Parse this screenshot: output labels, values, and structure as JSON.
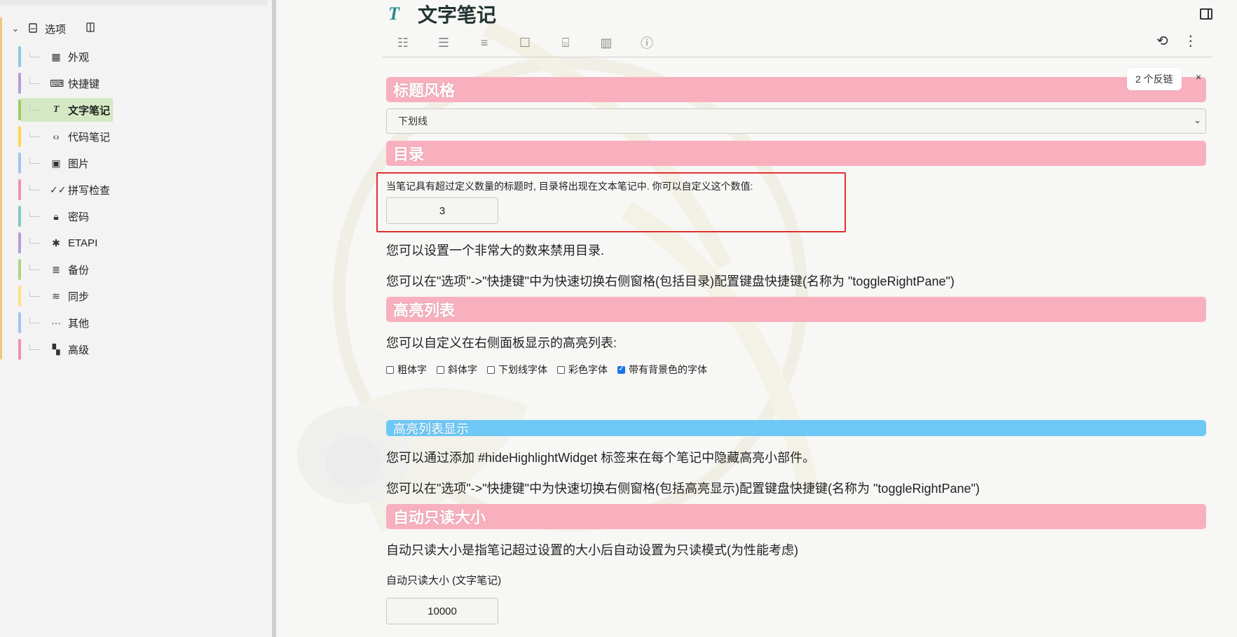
{
  "sidebar": {
    "root": {
      "label": "选项",
      "expander": "⌄"
    },
    "items": [
      {
        "label": "外观",
        "icon": "layout-icon",
        "color": "#8fc8e8"
      },
      {
        "label": "快捷键",
        "icon": "keyboard-icon",
        "color": "#b39ddb"
      },
      {
        "label": "文字笔记",
        "icon": "text-t-icon",
        "color": "#9ccc65",
        "active": true
      },
      {
        "label": "代码笔记",
        "icon": "code-icon",
        "color": "#ffd54f"
      },
      {
        "label": "图片",
        "icon": "image-icon",
        "color": "#a3c4f3"
      },
      {
        "label": "拼写检查",
        "icon": "spell-check-icon",
        "color": "#f48fb1"
      },
      {
        "label": "密码",
        "icon": "lock-icon",
        "color": "#80cbc4"
      },
      {
        "label": "ETAPI",
        "icon": "puzzle-icon",
        "color": "#b39ddb"
      },
      {
        "label": "备份",
        "icon": "database-icon",
        "color": "#aed581"
      },
      {
        "label": "同步",
        "icon": "wifi-icon",
        "color": "#ffe082"
      },
      {
        "label": "其他",
        "icon": "dots-icon",
        "color": "#a3c4f3"
      },
      {
        "label": "高级",
        "icon": "grid-icon",
        "color": "#f48fb1"
      }
    ]
  },
  "note": {
    "title_icon": "T",
    "title": "文字笔记",
    "backlinks": "2 个反链",
    "close": "×"
  },
  "sections": {
    "heading_style": {
      "title": "标题风格",
      "selected": "下划线"
    },
    "toc": {
      "title": "目录",
      "description": "当笔记具有超过定义数量的标题时, 目录将出现在文本笔记中. 你可以自定义这个数值:",
      "value": "3",
      "para1": "您可以设置一个非常大的数来禁用目录.",
      "para2": "您可以在\"选项\"->\"快捷键\"中为快速切换右侧窗格(包括目录)配置键盘快捷键(名称为 \"toggleRightPane\")"
    },
    "highlights": {
      "title": "高亮列表",
      "description": "您可以自定义在右侧面板显示的高亮列表:",
      "options": [
        {
          "label": "粗体字",
          "checked": false
        },
        {
          "label": "斜体字",
          "checked": false
        },
        {
          "label": "下划线字体",
          "checked": false
        },
        {
          "label": "彩色字体",
          "checked": false
        },
        {
          "label": "带有背景色的字体",
          "checked": true
        }
      ]
    },
    "highlights_display": {
      "title": "高亮列表显示",
      "para1": "您可以通过添加 #hideHighlightWidget 标签来在每个笔记中隐藏高亮小部件。",
      "para2": "您可以在\"选项\"->\"快捷键\"中为快速切换右侧窗格(包括高亮显示)配置键盘快捷键(名称为 \"toggleRightPane\")"
    },
    "auto_readonly": {
      "title": "自动只读大小",
      "description": "自动只读大小是指笔记超过设置的大小后自动设置为只读模式(为性能考虑)",
      "label": "自动只读大小 (文字笔记)",
      "value": "10000"
    }
  },
  "colors": {
    "heading_bar": "#f8b0bf",
    "blue_bar": "#6ec8f5",
    "highlight_box": "#e03030",
    "active_item": "#d4e8c4"
  }
}
